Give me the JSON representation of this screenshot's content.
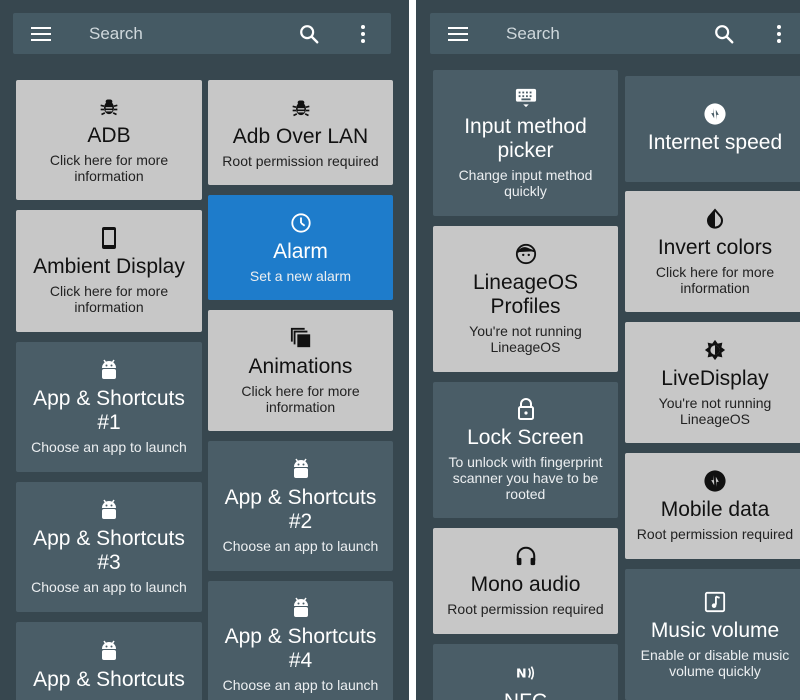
{
  "left_panel": {
    "search_placeholder": "Search",
    "tiles": [
      {
        "title": "ADB",
        "subtitle": "Click here for more information",
        "icon": "bug-icon"
      },
      {
        "title": "Adb Over LAN",
        "subtitle": "Root permission required",
        "icon": "bug-icon"
      },
      {
        "title": "Ambient Display",
        "subtitle": "Click here for more information",
        "icon": "phone-icon"
      },
      {
        "title": "Alarm",
        "subtitle": "Set a new alarm",
        "icon": "clock-icon",
        "state": "active"
      },
      {
        "title": "App & Shortcuts #1",
        "subtitle": "Choose an app to launch",
        "icon": "android-icon"
      },
      {
        "title": "Animations",
        "subtitle": "Click here for more information",
        "icon": "layers-icon"
      },
      {
        "title": "App & Shortcuts #3",
        "subtitle": "Choose an app to launch",
        "icon": "android-icon"
      },
      {
        "title": "App & Shortcuts #2",
        "subtitle": "Choose an app to launch",
        "icon": "android-icon"
      },
      {
        "title": "App & Shortcuts",
        "subtitle": "",
        "icon": "android-icon"
      },
      {
        "title": "App & Shortcuts #4",
        "subtitle": "Choose an app to launch",
        "icon": "android-icon"
      }
    ]
  },
  "right_panel": {
    "search_placeholder": "Search",
    "tiles": [
      {
        "title": "Input method picker",
        "subtitle": "Change input method quickly",
        "icon": "keyboard-icon"
      },
      {
        "title": "Internet speed",
        "subtitle": "",
        "icon": "speed-icon"
      },
      {
        "title": "Invert colors",
        "subtitle": "Click here for more information",
        "icon": "invert-icon"
      },
      {
        "title": "LineageOS Profiles",
        "subtitle": "You're not running LineageOS",
        "icon": "face-icon"
      },
      {
        "title": "LiveDisplay",
        "subtitle": "You're not running LineageOS",
        "icon": "brightness-icon"
      },
      {
        "title": "Lock Screen",
        "subtitle": "To unlock with fingerprint scanner you have to be rooted",
        "icon": "lock-icon"
      },
      {
        "title": "Mobile data",
        "subtitle": "Root permission required",
        "icon": "data-icon"
      },
      {
        "title": "Mono audio",
        "subtitle": "Root permission required",
        "icon": "headphones-icon"
      },
      {
        "title": "Music volume",
        "subtitle": "Enable or disable music volume quickly",
        "icon": "music-icon"
      },
      {
        "title": "NFC",
        "subtitle": "",
        "icon": "nfc-icon"
      }
    ]
  },
  "colors": {
    "background": "#37474f",
    "tile_dark": "#4a5d67",
    "tile_light": "#c7c7c7",
    "tile_active": "#1e7ccb"
  }
}
